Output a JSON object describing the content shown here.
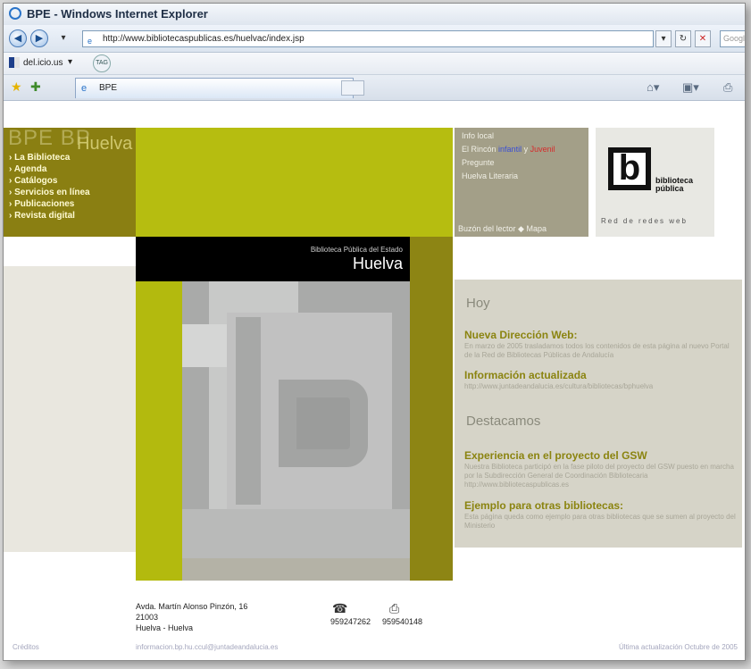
{
  "browser": {
    "title": "BPE - Windows Internet Explorer",
    "url": "http://www.bibliotecaspublicas.es/huelvac/index.jsp",
    "search_placeholder": "Google",
    "links_bar": {
      "delicious": "del.icio.us",
      "tag": "TAG"
    },
    "tab_title": "BPE"
  },
  "site": {
    "logo_bpe": "BPE BP",
    "logo_city": "Huelva",
    "menu": [
      "La Biblioteca",
      "Agenda",
      "Catálogos",
      "Servicios en línea",
      "Publicaciones",
      "Revista digital"
    ],
    "info_links": {
      "info_local": "Info local",
      "rincon_prefix": "El Rincón",
      "rincon_infantil": "infantil",
      "rincon_y": "y",
      "rincon_juvenil": "Juvenil",
      "pregunte": "Pregunte",
      "huelva_literaria": "Huelva Literaria"
    },
    "info_footer": "Buzón del lector  ◆ Mapa",
    "brand": {
      "name_line1": "biblioteca",
      "name_line2": "pública",
      "tagline": "Red de redes web",
      "mark": "b"
    },
    "poster": {
      "subline": "Biblioteca Pública del Estado",
      "city": "Huelva"
    },
    "hoy": {
      "heading": "Hoy",
      "items": [
        {
          "title": "Nueva Dirección Web:",
          "body": "En marzo de 2005 trasladamos todos los contenidos de esta página al nuevo Portal de la Red de Bibliotecas Públicas de Andalucía"
        },
        {
          "title": "Información actualizada",
          "body": "http://www.juntadeandalucia.es/cultura/bibliotecas/bphuelva"
        }
      ]
    },
    "destacamos": {
      "heading": "Destacamos",
      "items": [
        {
          "title": "Experiencia en el proyecto del GSW",
          "body": "Nuestra Biblioteca participó en la fase piloto del proyecto del GSW puesto en marcha por la Subdirección General de Coordinación Bibliotecaria http://www.bibliotecaspublicas.es"
        },
        {
          "title": "Ejemplo para otras bibliotecas:",
          "body": "Esta página queda como ejemplo para otras bibliotecas que se sumen al proyecto del Ministerio"
        }
      ]
    },
    "address": {
      "line1": "Avda. Martín Alonso Pinzón, 16",
      "line2": "21003",
      "line3": "Huelva - Huelva"
    },
    "phone": "959247262",
    "fax": "959540148",
    "footer": {
      "credits": "Créditos",
      "email": "informacion.bp.hu.ccul@juntadeandalucia.es",
      "updated": "Última actualización Octubre de 2005"
    }
  }
}
